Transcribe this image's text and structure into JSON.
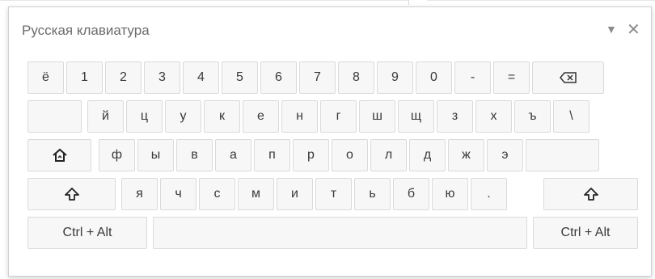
{
  "window": {
    "title": "Русская клавиатура",
    "minimize_icon": "triangle-down-icon",
    "close_icon": "close-icon"
  },
  "rows": [
    [
      "ё",
      "1",
      "2",
      "3",
      "4",
      "5",
      "6",
      "7",
      "8",
      "9",
      "0",
      "-",
      "="
    ],
    [
      "й",
      "ц",
      "у",
      "к",
      "е",
      "н",
      "г",
      "ш",
      "щ",
      "з",
      "х",
      "ъ",
      "\\"
    ],
    [
      "ф",
      "ы",
      "в",
      "а",
      "п",
      "р",
      "о",
      "л",
      "д",
      "ж",
      "э"
    ],
    [
      "я",
      "ч",
      "с",
      "м",
      "и",
      "т",
      "ь",
      "б",
      "ю",
      "."
    ]
  ],
  "special_keys": {
    "backspace_icon": "backspace-icon",
    "caps_icon": "home-capslock-icon",
    "shift_icon": "shift-arrow-icon",
    "ctrl_alt_left": "Ctrl + Alt",
    "ctrl_alt_right": "Ctrl + Alt",
    "space": ""
  },
  "colors": {
    "key_bg": "#f7f7f7",
    "key_border": "#dadada",
    "text": "#3a3a3a"
  }
}
